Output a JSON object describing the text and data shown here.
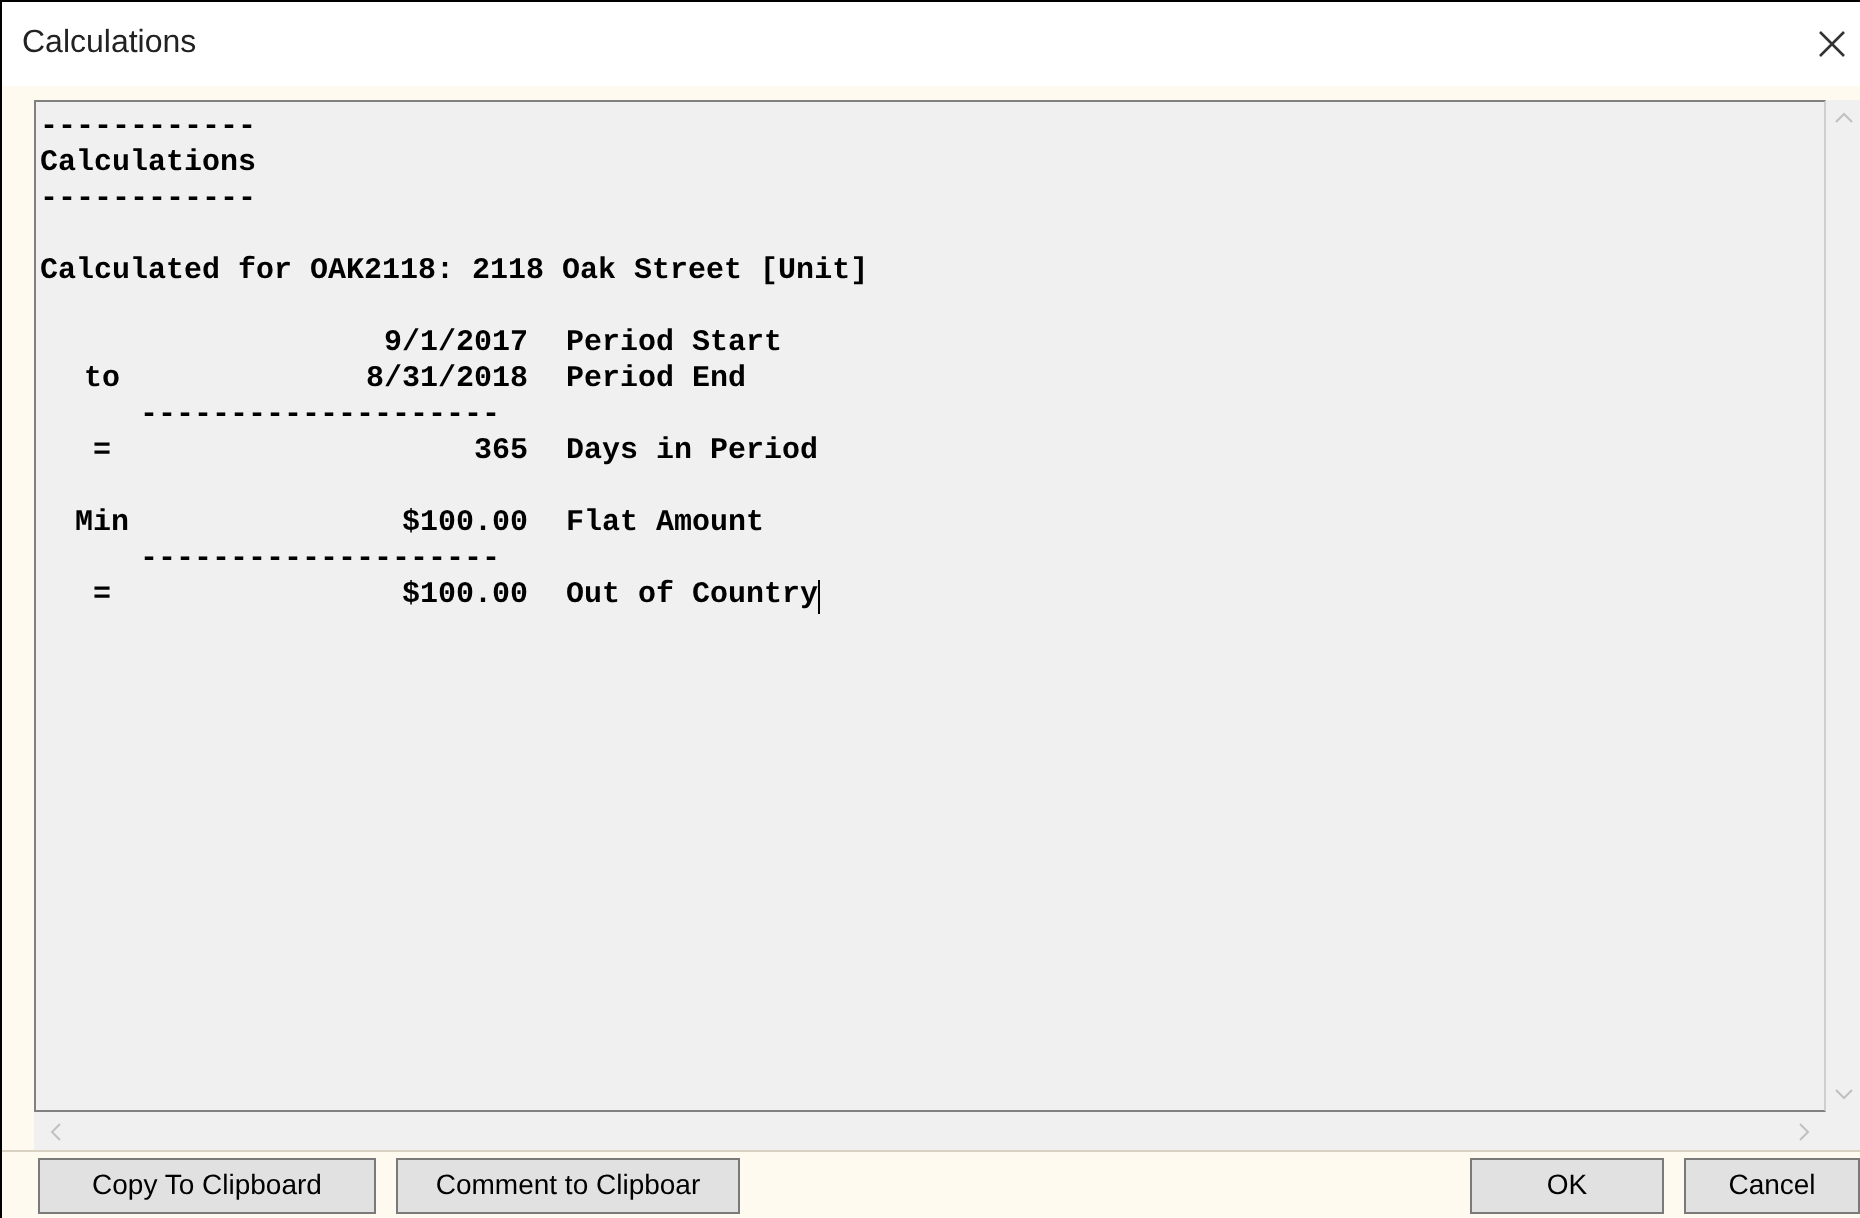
{
  "window": {
    "title": "Calculations"
  },
  "report": {
    "lines": [
      {
        "kind": "text",
        "text": "------------"
      },
      {
        "kind": "text",
        "text": "Calculations"
      },
      {
        "kind": "text",
        "text": "------------"
      },
      {
        "kind": "blank"
      },
      {
        "kind": "text",
        "text": "Calculated for OAK2118: 2118 Oak Street [Unit]"
      },
      {
        "kind": "blank"
      },
      {
        "kind": "row",
        "value": "9/1/2017",
        "label": "Period Start"
      },
      {
        "kind": "row",
        "op": "to",
        "value": "8/31/2018",
        "label": "Period End"
      },
      {
        "kind": "rule",
        "text": "--------------------"
      },
      {
        "kind": "row",
        "op": "=",
        "value": "365",
        "label": "Days in Period"
      },
      {
        "kind": "blank"
      },
      {
        "kind": "row",
        "op": "Min",
        "value": "$100.00",
        "label": "Flat Amount"
      },
      {
        "kind": "rule",
        "text": "--------------------"
      },
      {
        "kind": "row",
        "op": "=",
        "value": "$100.00",
        "label": "Out of Country",
        "caret": true
      }
    ]
  },
  "left_buttons": [
    "Copy To Clipboard",
    "Comment to Clipboar"
  ],
  "right_buttons": [
    "OK",
    "Cancel"
  ]
}
